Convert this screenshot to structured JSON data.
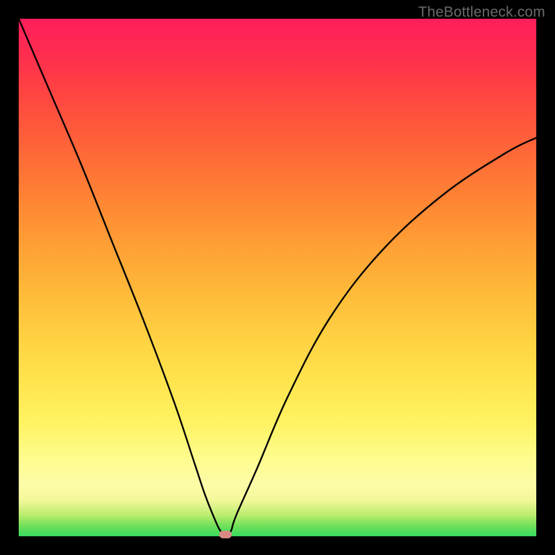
{
  "watermark": "TheBottleneck.com",
  "chart_data": {
    "type": "line",
    "title": "",
    "xlabel": "",
    "ylabel": "",
    "xlim": [
      0,
      100
    ],
    "ylim": [
      0,
      100
    ],
    "grid": false,
    "series": [
      {
        "name": "bottleneck-curve",
        "x": [
          0,
          6,
          12,
          18,
          24,
          30,
          34,
          36,
          38,
          39,
          40,
          41,
          42,
          46,
          52,
          60,
          70,
          82,
          94,
          100
        ],
        "values": [
          100,
          86,
          72,
          57,
          42,
          26,
          14,
          8,
          3,
          1,
          0,
          1,
          4,
          13,
          27,
          42,
          55,
          66,
          74,
          77
        ]
      }
    ],
    "annotations": [
      {
        "name": "min-marker",
        "x": 40,
        "y": 0
      }
    ],
    "gradient_stops": [
      {
        "y": 0,
        "color": "#37da5e"
      },
      {
        "y": 10,
        "color": "#fdfca8"
      },
      {
        "y": 30,
        "color": "#ffe44e"
      },
      {
        "y": 60,
        "color": "#ff8e34"
      },
      {
        "y": 100,
        "color": "#ff1e5c"
      }
    ]
  }
}
